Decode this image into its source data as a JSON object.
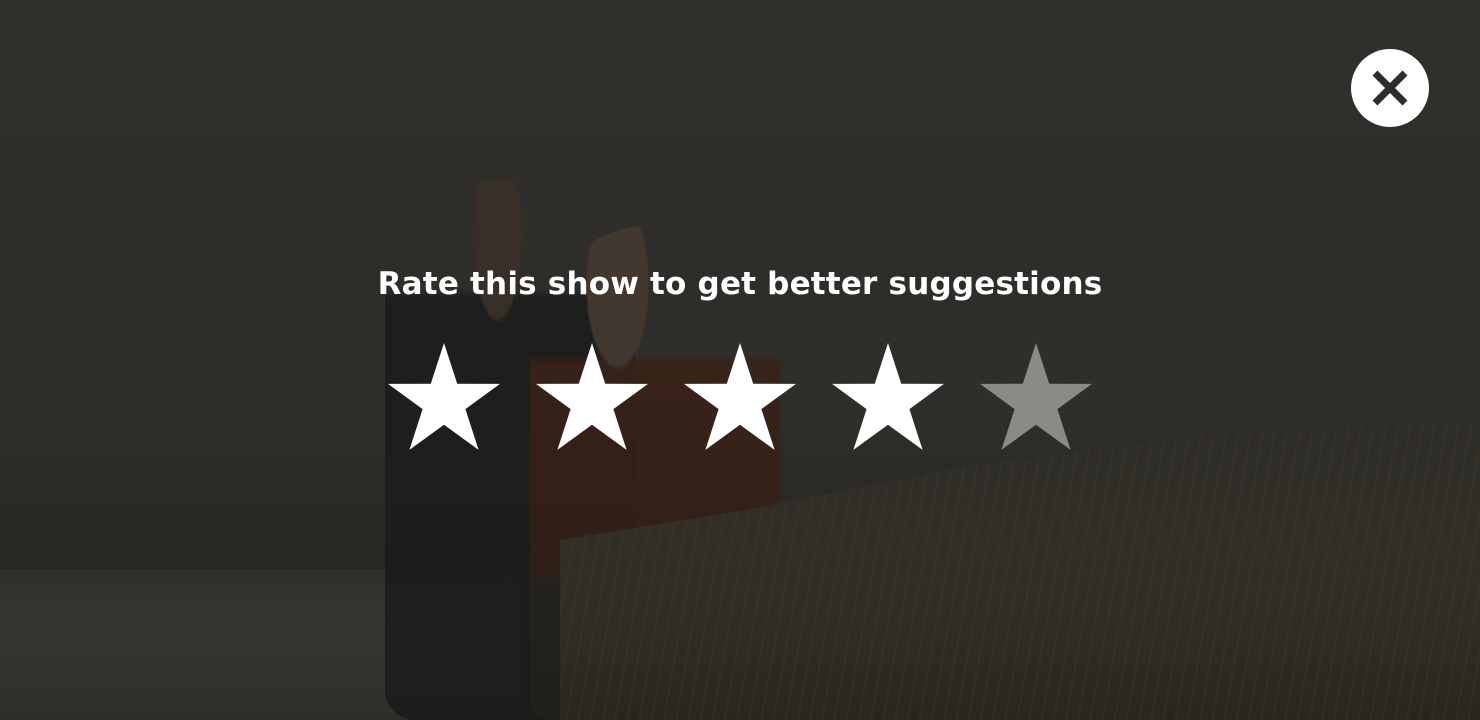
{
  "dialog": {
    "title": "Rate this show to get better suggestions",
    "close_icon": "close-icon"
  },
  "rating": {
    "max": 5,
    "value": 4,
    "star_icon": "star-icon",
    "colors": {
      "filled": "#ffffff",
      "empty": "#8c8a87"
    }
  },
  "colors": {
    "overlay": "#2e2c29",
    "close_button_bg": "#ffffff",
    "close_glyph": "#2f2d2a"
  }
}
